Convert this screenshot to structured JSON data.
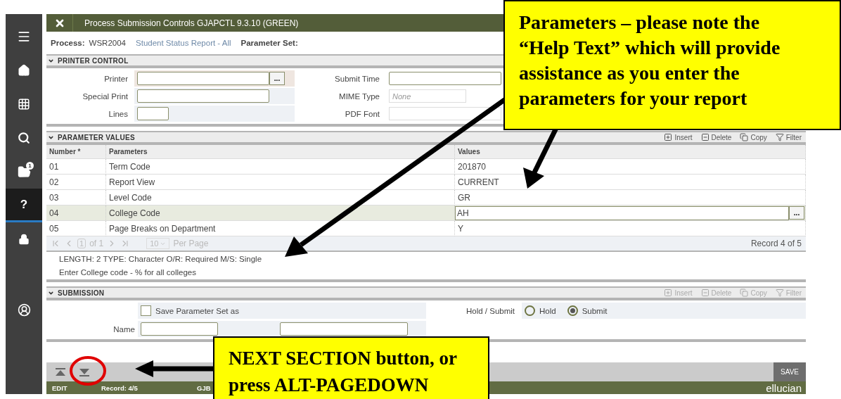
{
  "sidebar": {
    "items": [
      {
        "kind": "menu",
        "selected": false
      },
      {
        "kind": "home",
        "selected": false
      },
      {
        "kind": "apps",
        "selected": false
      },
      {
        "kind": "search",
        "selected": false
      },
      {
        "kind": "folder",
        "selected": false,
        "badge": "1"
      },
      {
        "kind": "help",
        "selected": true,
        "label": "?"
      },
      {
        "kind": "lock",
        "selected": false
      },
      {
        "kind": "user",
        "selected": false
      }
    ]
  },
  "window": {
    "title": "Process Submission Controls GJAPCTL 9.3.10 (GREEN)"
  },
  "process": {
    "label": "Process:",
    "code": "WSR2004",
    "name": "Student Status Report - All",
    "parameter_set_label": "Parameter Set:"
  },
  "printer_control": {
    "title": "PRINTER CONTROL",
    "left_fields": [
      {
        "label": "Printer",
        "kind": "lookup",
        "button": "..."
      },
      {
        "label": "Special Print",
        "kind": "text"
      },
      {
        "label": "Lines",
        "kind": "short"
      }
    ],
    "right_fields": [
      {
        "label": "Submit Time",
        "kind": "text"
      },
      {
        "label": "MIME Type",
        "kind": "readonly",
        "placeholder": "None"
      },
      {
        "label": "PDF Font",
        "kind": "readonly"
      }
    ]
  },
  "parameter_values": {
    "title": "PARAMETER VALUES",
    "toolbar": [
      {
        "kind": "insert",
        "label": "Insert",
        "disabled": false
      },
      {
        "kind": "delete",
        "label": "Delete",
        "disabled": false
      },
      {
        "kind": "copy",
        "label": "Copy",
        "disabled": false
      },
      {
        "kind": "filter",
        "label": "Filter",
        "disabled": false
      }
    ],
    "columns": [
      "Number *",
      "Parameters",
      "Values"
    ],
    "rows": [
      {
        "number": "01",
        "parameter": "Term Code",
        "value": "201870",
        "selected": false
      },
      {
        "number": "02",
        "parameter": "Report View",
        "value": "CURRENT",
        "selected": false
      },
      {
        "number": "03",
        "parameter": "Level Code",
        "value": "GR",
        "selected": false
      },
      {
        "number": "04",
        "parameter": "College Code",
        "value": "AH",
        "selected": true,
        "button": "..."
      },
      {
        "number": "05",
        "parameter": "Page Breaks on Department",
        "value": "Y",
        "selected": false
      }
    ],
    "pager": {
      "page": "1",
      "of": "of 1",
      "per_page": "10",
      "per_page_label": "Per Page",
      "record": "Record 4 of 5"
    },
    "help_text": [
      "LENGTH: 2 TYPE: Character O/R: Required M/S: Single",
      "Enter College code - % for all colleges"
    ]
  },
  "submission": {
    "title": "SUBMISSION",
    "toolbar": [
      {
        "kind": "insert",
        "label": "Insert",
        "disabled": true
      },
      {
        "kind": "delete",
        "label": "Delete",
        "disabled": true
      },
      {
        "kind": "copy",
        "label": "Copy",
        "disabled": true
      },
      {
        "kind": "filter",
        "label": "Filter",
        "disabled": true
      }
    ],
    "save_set": {
      "label": "Save Parameter Set as",
      "checked": false
    },
    "name_label": "Name",
    "hold_submit_label": "Hold / Submit",
    "options": [
      {
        "label": "Hold",
        "selected": false
      },
      {
        "label": "Submit",
        "selected": true
      }
    ]
  },
  "bottom_bar": {
    "save": "SAVE"
  },
  "status_bar": {
    "mode": "EDIT",
    "record": "Record: 4/5",
    "form": "GJB",
    "brand": "ellucian"
  },
  "annotations": [
    {
      "kind": "top",
      "text": "Parameters – please note the “Help Text” which will provide assistance as you enter the parameters for your report"
    },
    {
      "kind": "bottom",
      "text": "NEXT SECTION button, or press ALT-PAGEDOWN"
    }
  ]
}
